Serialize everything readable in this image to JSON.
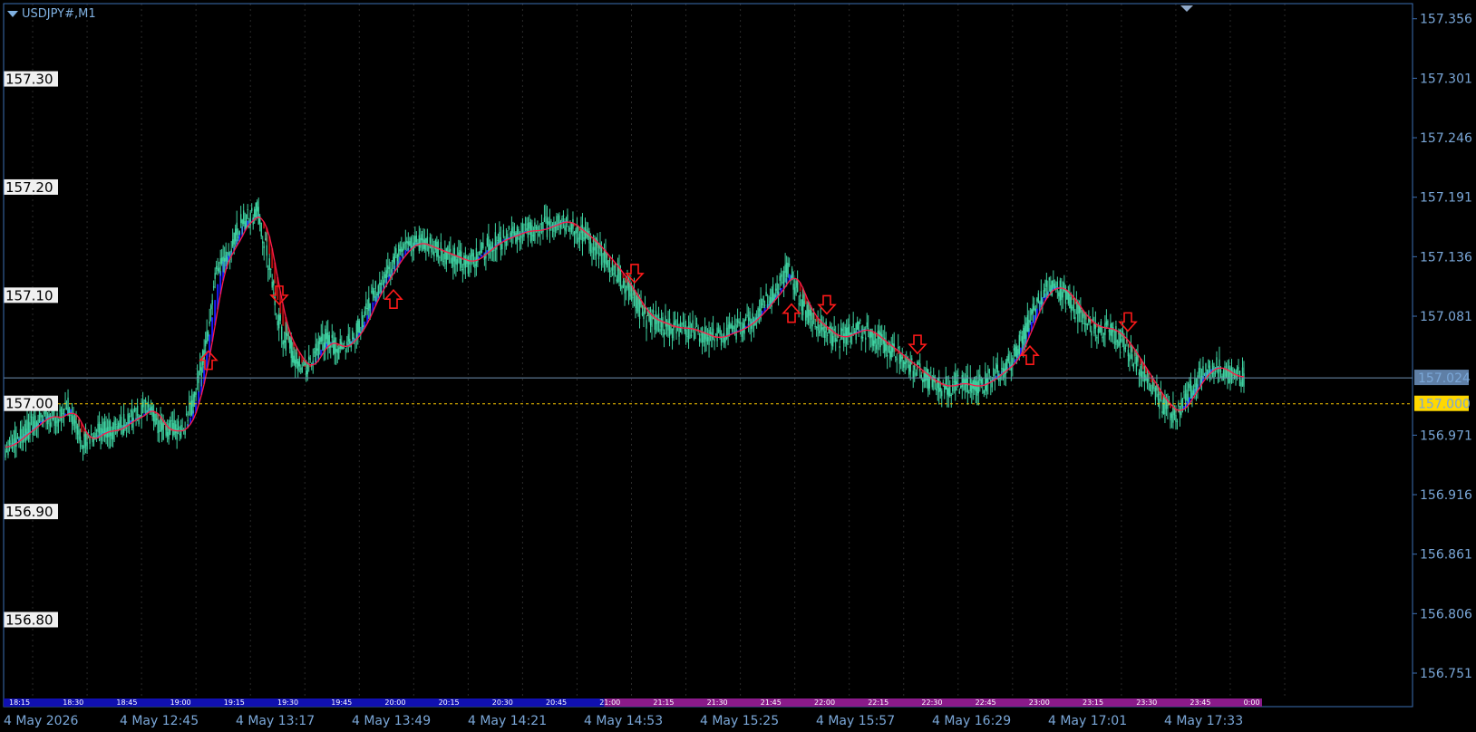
{
  "window": {
    "symbol_label": "USDJPY#,M1"
  },
  "colors": {
    "background": "#000000",
    "axis": "#3d6fb3",
    "axis_text": "#7aa7d8",
    "candle": "#3fd3a2",
    "ma_up_fill": "#1a1aff",
    "ma_down_fill": "#b01010",
    "ma_line": "#ff1a4a",
    "arrow": "#ff1a1a",
    "current_price_bg": "#5f7fa6",
    "level_line": "#ffcc00",
    "level_box_bg": "#ffd800",
    "strip_blue": "#1010b0",
    "strip_purple": "#8a1a8a"
  },
  "chart_data": {
    "type": "candlestick",
    "title": "USDJPY#,M1",
    "ylim": [
      156.72,
      157.37
    ],
    "price_axis_ticks": [
      "157.356",
      "157.301",
      "157.246",
      "157.191",
      "157.136",
      "157.081",
      "157.024",
      "156.971",
      "156.916",
      "156.861",
      "156.806",
      "156.751"
    ],
    "current_price": "157.024",
    "level_price": "157.000",
    "level_labels": [
      {
        "text": "157.30",
        "price": 157.3
      },
      {
        "text": "157.20",
        "price": 157.2
      },
      {
        "text": "157.10",
        "price": 157.1
      },
      {
        "text": "157.00",
        "price": 157.0
      },
      {
        "text": "156.90",
        "price": 156.9
      },
      {
        "text": "156.80",
        "price": 156.8
      }
    ],
    "x_axis_labels": [
      "4 May 2026",
      "4 May 12:45",
      "4 May 13:17",
      "4 May 13:49",
      "4 May 14:21",
      "4 May 14:53",
      "4 May 15:25",
      "4 May 15:57",
      "4 May 16:29",
      "4 May 17:01",
      "4 May 17:33"
    ],
    "strip_time_labels": [
      "18:15",
      "18:30",
      "18:45",
      "19:00",
      "19:15",
      "19:30",
      "19:45",
      "20:00",
      "20:15",
      "20:30",
      "20:45",
      "21:00",
      "21:15",
      "21:30",
      "21:45",
      "22:00",
      "22:15",
      "22:30",
      "22:45",
      "23:00",
      "23:15",
      "23:30",
      "23:45",
      "0:00"
    ],
    "price_path": [
      [
        0,
        156.96
      ],
      [
        10,
        156.97
      ],
      [
        20,
        156.98
      ],
      [
        30,
        156.99
      ],
      [
        40,
        156.985
      ],
      [
        45,
        157.0
      ],
      [
        50,
        156.985
      ],
      [
        55,
        156.97
      ],
      [
        60,
        156.965
      ],
      [
        70,
        156.975
      ],
      [
        80,
        156.975
      ],
      [
        90,
        156.985
      ],
      [
        100,
        156.99
      ],
      [
        105,
        157.0
      ],
      [
        110,
        156.985
      ],
      [
        115,
        156.975
      ],
      [
        120,
        156.975
      ],
      [
        130,
        156.975
      ],
      [
        138,
        157.0
      ],
      [
        145,
        157.04
      ],
      [
        150,
        157.08
      ],
      [
        155,
        157.12
      ],
      [
        160,
        157.14
      ],
      [
        165,
        157.14
      ],
      [
        170,
        157.16
      ],
      [
        175,
        157.17
      ],
      [
        180,
        157.17
      ],
      [
        185,
        157.18
      ],
      [
        190,
        157.15
      ],
      [
        195,
        157.12
      ],
      [
        200,
        157.08
      ],
      [
        205,
        157.06
      ],
      [
        210,
        157.05
      ],
      [
        215,
        157.04
      ],
      [
        220,
        157.03
      ],
      [
        225,
        157.04
      ],
      [
        230,
        157.05
      ],
      [
        235,
        157.06
      ],
      [
        240,
        157.055
      ],
      [
        245,
        157.05
      ],
      [
        250,
        157.055
      ],
      [
        260,
        157.07
      ],
      [
        270,
        157.1
      ],
      [
        280,
        157.12
      ],
      [
        290,
        157.14
      ],
      [
        300,
        157.15
      ],
      [
        310,
        157.145
      ],
      [
        320,
        157.14
      ],
      [
        330,
        157.135
      ],
      [
        340,
        157.13
      ],
      [
        350,
        157.14
      ],
      [
        360,
        157.15
      ],
      [
        370,
        157.155
      ],
      [
        380,
        157.16
      ],
      [
        390,
        157.16
      ],
      [
        400,
        157.165
      ],
      [
        410,
        157.17
      ],
      [
        420,
        157.16
      ],
      [
        430,
        157.15
      ],
      [
        440,
        157.135
      ],
      [
        450,
        157.12
      ],
      [
        460,
        157.1
      ],
      [
        470,
        157.08
      ],
      [
        480,
        157.075
      ],
      [
        490,
        157.07
      ],
      [
        500,
        157.07
      ],
      [
        510,
        157.065
      ],
      [
        520,
        157.06
      ],
      [
        530,
        157.065
      ],
      [
        540,
        157.07
      ],
      [
        550,
        157.08
      ],
      [
        560,
        157.095
      ],
      [
        570,
        157.11
      ],
      [
        575,
        157.125
      ],
      [
        580,
        157.11
      ],
      [
        590,
        157.08
      ],
      [
        600,
        157.07
      ],
      [
        610,
        157.06
      ],
      [
        620,
        157.065
      ],
      [
        630,
        157.07
      ],
      [
        640,
        157.06
      ],
      [
        650,
        157.05
      ],
      [
        660,
        157.04
      ],
      [
        670,
        157.03
      ],
      [
        680,
        157.02
      ],
      [
        690,
        157.015
      ],
      [
        700,
        157.02
      ],
      [
        710,
        157.015
      ],
      [
        720,
        157.02
      ],
      [
        730,
        157.03
      ],
      [
        740,
        157.04
      ],
      [
        750,
        157.07
      ],
      [
        760,
        157.1
      ],
      [
        770,
        157.11
      ],
      [
        780,
        157.1
      ],
      [
        790,
        157.08
      ],
      [
        800,
        157.07
      ],
      [
        810,
        157.07
      ],
      [
        820,
        157.06
      ],
      [
        830,
        157.04
      ],
      [
        840,
        157.02
      ],
      [
        850,
        157.0
      ],
      [
        860,
        156.99
      ],
      [
        870,
        157.01
      ],
      [
        880,
        157.03
      ],
      [
        890,
        157.035
      ],
      [
        900,
        157.025
      ],
      [
        910,
        157.025
      ]
    ],
    "arrows": [
      {
        "dir": "up",
        "t": 230
      },
      {
        "dir": "down",
        "t": 308
      },
      {
        "dir": "up",
        "t": 434
      },
      {
        "dir": "down",
        "t": 700
      },
      {
        "dir": "up",
        "t": 873
      },
      {
        "dir": "down",
        "t": 912
      },
      {
        "dir": "down",
        "t": 1012
      },
      {
        "dir": "up",
        "t": 1136
      },
      {
        "dir": "down",
        "t": 1244
      }
    ]
  }
}
